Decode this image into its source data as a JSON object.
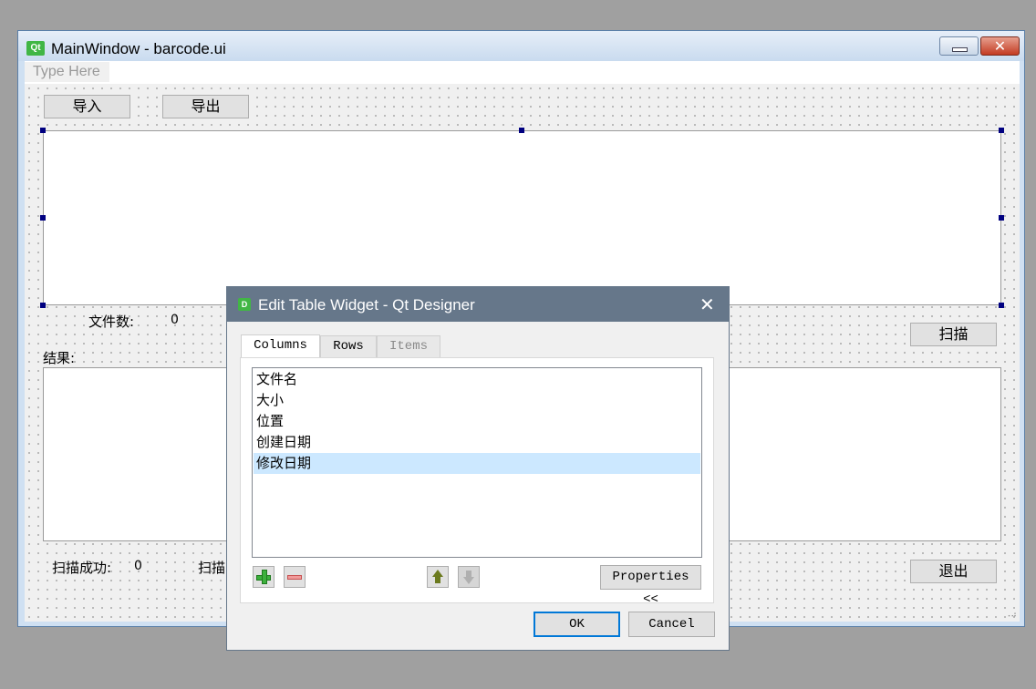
{
  "main_window": {
    "title": "MainWindow - barcode.ui",
    "logo_text": "Qt",
    "close_glyph": "✕",
    "menubar_placeholder": "Type Here"
  },
  "form": {
    "import_button": "导入",
    "export_button": "导出",
    "file_count_label": "文件数:",
    "file_count_value": "0",
    "scan_button": "扫描",
    "results_label": "结果:",
    "scan_success_label": "扫描成功:",
    "scan_success_value": "0",
    "scan_partial_label": "扫描",
    "exit_button": "退出",
    "resize_grip": "⠠⠴"
  },
  "dialog": {
    "title": "Edit Table Widget - Qt Designer",
    "logo_text": "D",
    "close_glyph": "✕",
    "tabs": [
      {
        "label": "Columns",
        "state": "active"
      },
      {
        "label": "Rows",
        "state": "normal"
      },
      {
        "label": "Items",
        "state": "disabled"
      }
    ],
    "columns": [
      {
        "label": "文件名",
        "selected": false
      },
      {
        "label": "大小",
        "selected": false
      },
      {
        "label": "位置",
        "selected": false
      },
      {
        "label": "创建日期",
        "selected": false
      },
      {
        "label": "修改日期",
        "selected": true
      }
    ],
    "icons": [
      "plus-icon",
      "minus-icon",
      "arrow-up-icon",
      "arrow-down-icon"
    ],
    "properties_button": "Properties <<",
    "ok_button": "OK",
    "cancel_button": "Cancel"
  },
  "colors": {
    "dialog_title_bar": "#66778a",
    "selection": "#cce8ff",
    "qt_green": "#41b645",
    "handle": "#000080"
  }
}
